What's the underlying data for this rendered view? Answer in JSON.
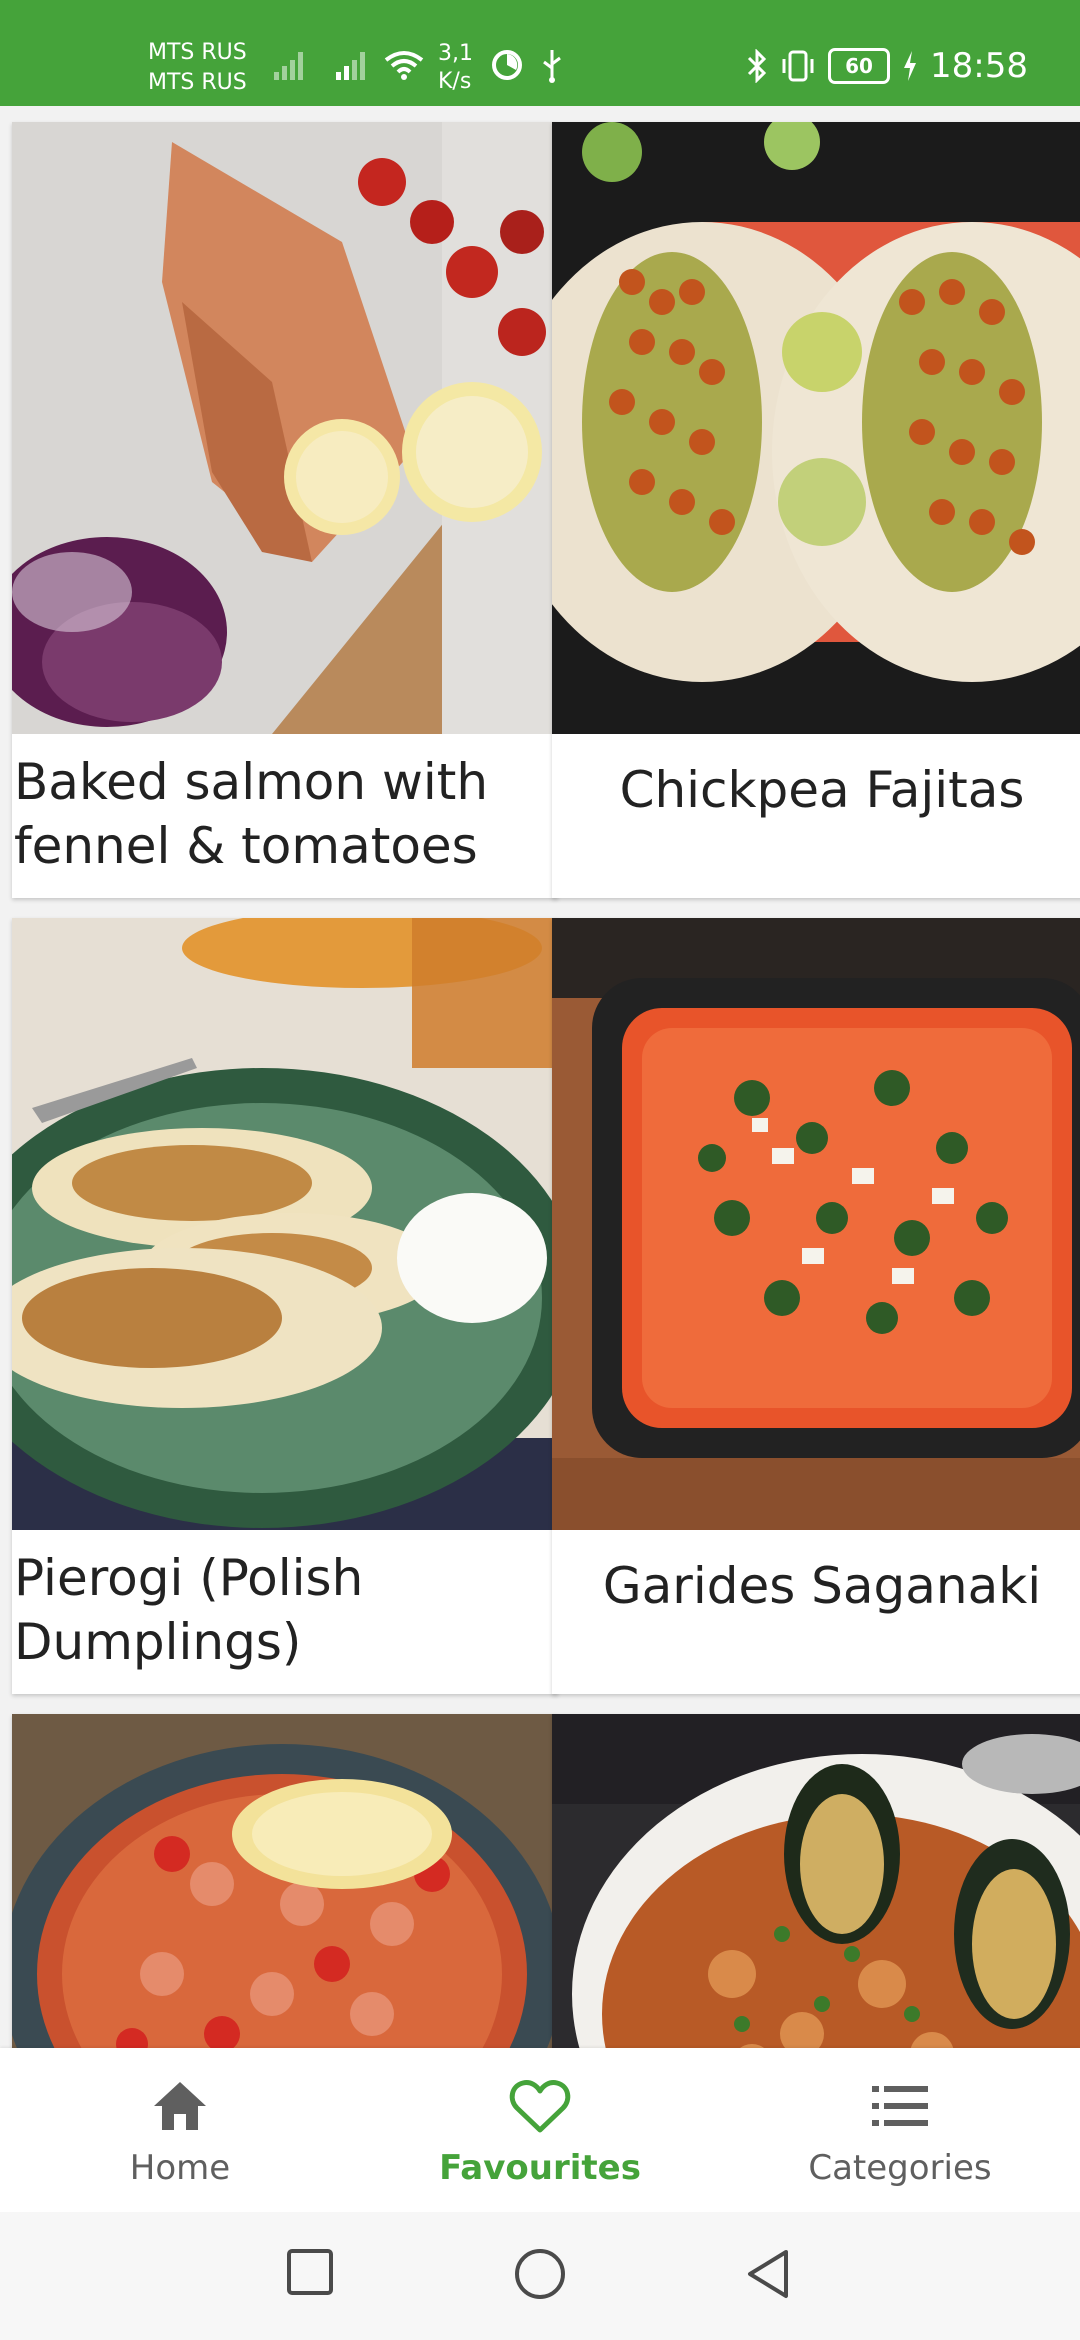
{
  "status_bar": {
    "carrier_1": "MTS RUS",
    "carrier_2": "MTS RUS",
    "speed_value": "3,1",
    "speed_unit": "K/s",
    "battery": "60",
    "time": "18:58",
    "background": "#45a33a"
  },
  "recipes": [
    {
      "title": "Baked salmon with fennel & tomatoes"
    },
    {
      "title": "Chickpea Fajitas"
    },
    {
      "title": "Pierogi (Polish Dumplings)"
    },
    {
      "title": "Garides Saganaki"
    }
  ],
  "bottom_nav": {
    "items": [
      {
        "label": "Home",
        "icon": "home-icon",
        "active": false
      },
      {
        "label": "Favourites",
        "icon": "heart-icon",
        "active": true
      },
      {
        "label": "Categories",
        "icon": "list-icon",
        "active": false
      }
    ],
    "active_color": "#45a33a",
    "inactive_color": "#5f5f5f"
  },
  "system_nav": {
    "buttons": [
      "recents-icon",
      "home-circle-icon",
      "back-icon"
    ]
  }
}
